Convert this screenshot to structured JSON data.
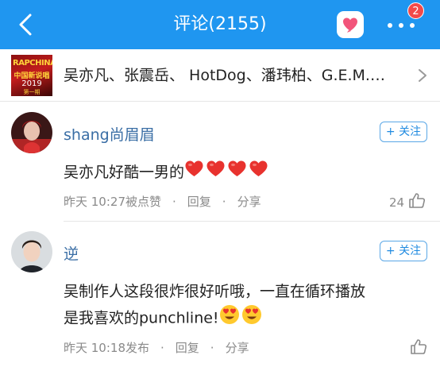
{
  "header": {
    "title": "评论(2155)",
    "notification_count": "2",
    "accent_color": "#1f96f0",
    "icons": [
      "back-arrow-icon",
      "heart-icon",
      "more-icon"
    ]
  },
  "topic": {
    "text": "吴亦凡、张震岳、 HotDog、潘玮柏、G.E.M.…",
    "thumbnail": {
      "line1": "RAPCHINA",
      "line2": "中国新说唱",
      "line3": "2019",
      "line4": "第一期"
    }
  },
  "comments": [
    {
      "username": "shang尚眉眉",
      "follow_label": "+ 关注",
      "text": "吴亦凡好酷一男的",
      "emojis": [
        "heart",
        "heart",
        "heart",
        "heart"
      ],
      "time": "昨天 10:27被点赞",
      "reply_label": "回复",
      "share_label": "分享",
      "like_count": "24"
    },
    {
      "username": "逆",
      "follow_label": "+ 关注",
      "text_line1": "吴制作人这段很炸很好听哦，一直在循环播放",
      "text_line2": "是我喜欢的punchline!",
      "emojis": [
        "heart-eyes",
        "heart-eyes"
      ],
      "time": "昨天 10:18发布",
      "reply_label": "回复",
      "share_label": "分享",
      "like_count": ""
    }
  ]
}
